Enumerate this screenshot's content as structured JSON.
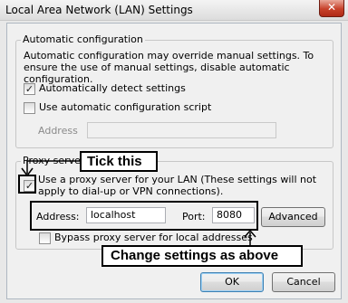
{
  "window": {
    "title": "Local Area Network (LAN) Settings",
    "close_glyph": "✕"
  },
  "auto_config": {
    "group_label": "Automatic configuration",
    "description": "Automatic configuration may override manual settings. To ensure the use of manual settings, disable automatic configuration.",
    "detect_label": "Automatically detect settings",
    "detect_checked": true,
    "script_label": "Use automatic configuration script",
    "script_checked": false,
    "address_label": "Address",
    "address_value": ""
  },
  "proxy": {
    "group_label": "Proxy server",
    "use_proxy_label": "Use a proxy server for your LAN (These settings will not apply to dial-up or VPN connections).",
    "use_proxy_checked": true,
    "address_label": "Address:",
    "address_value": "localhost",
    "port_label": "Port:",
    "port_value": "8080",
    "advanced_label": "Advanced",
    "bypass_label": "Bypass proxy server for local addresses",
    "bypass_checked": false
  },
  "buttons": {
    "ok_label": "OK",
    "cancel_label": "Cancel"
  },
  "annotations": {
    "tick_this": "Tick this",
    "change_settings": "Change settings as above"
  },
  "icons": {
    "check": "check-icon",
    "close": "close-icon"
  }
}
